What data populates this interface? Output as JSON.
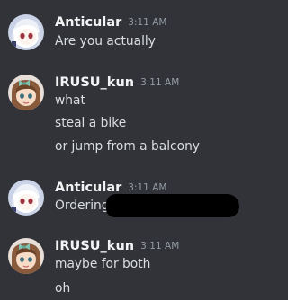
{
  "messages": [
    {
      "username": "Anticular",
      "timestamp": "3:11 AM",
      "avatar_icon": "anime-avatar-white-hair-icon",
      "lines": [
        "Are you actually"
      ]
    },
    {
      "username": "IRUSU_kun",
      "timestamp": "3:11 AM",
      "avatar_icon": "anime-avatar-brown-hair-bow-icon",
      "lines": [
        "what",
        "steal a bike",
        "or jump from a balcony"
      ]
    },
    {
      "username": "Anticular",
      "timestamp": "3:11 AM",
      "avatar_icon": "anime-avatar-white-hair-icon",
      "lines": [
        "Ordering"
      ],
      "redacted": true
    },
    {
      "username": "IRUSU_kun",
      "timestamp": "3:11 AM",
      "avatar_icon": "anime-avatar-brown-hair-bow-icon",
      "lines": [
        "maybe for both",
        "oh"
      ]
    }
  ],
  "colors": {
    "background": "#313338",
    "username": "#f2f3f5",
    "timestamp": "#949ba4",
    "message_text": "#dbdee1",
    "redaction": "#000000"
  }
}
